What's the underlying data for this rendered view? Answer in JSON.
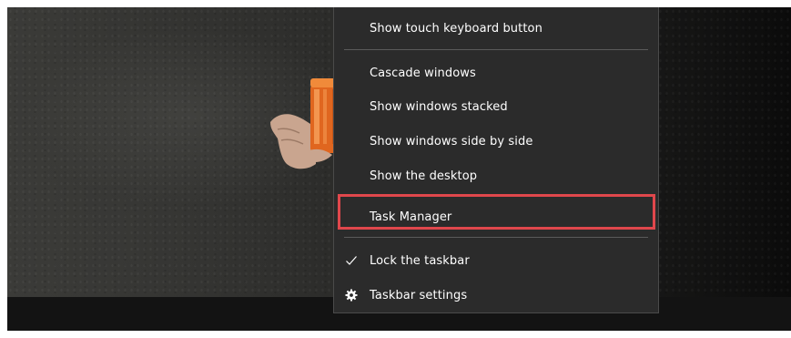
{
  "menu": {
    "items": [
      {
        "label": "Show touch keyboard button"
      },
      {
        "label": "Cascade windows"
      },
      {
        "label": "Show windows stacked"
      },
      {
        "label": "Show windows side by side"
      },
      {
        "label": "Show the desktop"
      },
      {
        "label": "Task Manager",
        "highlighted": true
      },
      {
        "label": "Lock the taskbar",
        "checked": true
      },
      {
        "label": "Taskbar settings",
        "icon": "gear-icon"
      }
    ]
  },
  "colors": {
    "menu_background": "#2b2b2b",
    "menu_text": "#ffffff",
    "highlight_border": "#e0474c",
    "separator": "#5a5a5a",
    "taskbar": "#131313"
  }
}
